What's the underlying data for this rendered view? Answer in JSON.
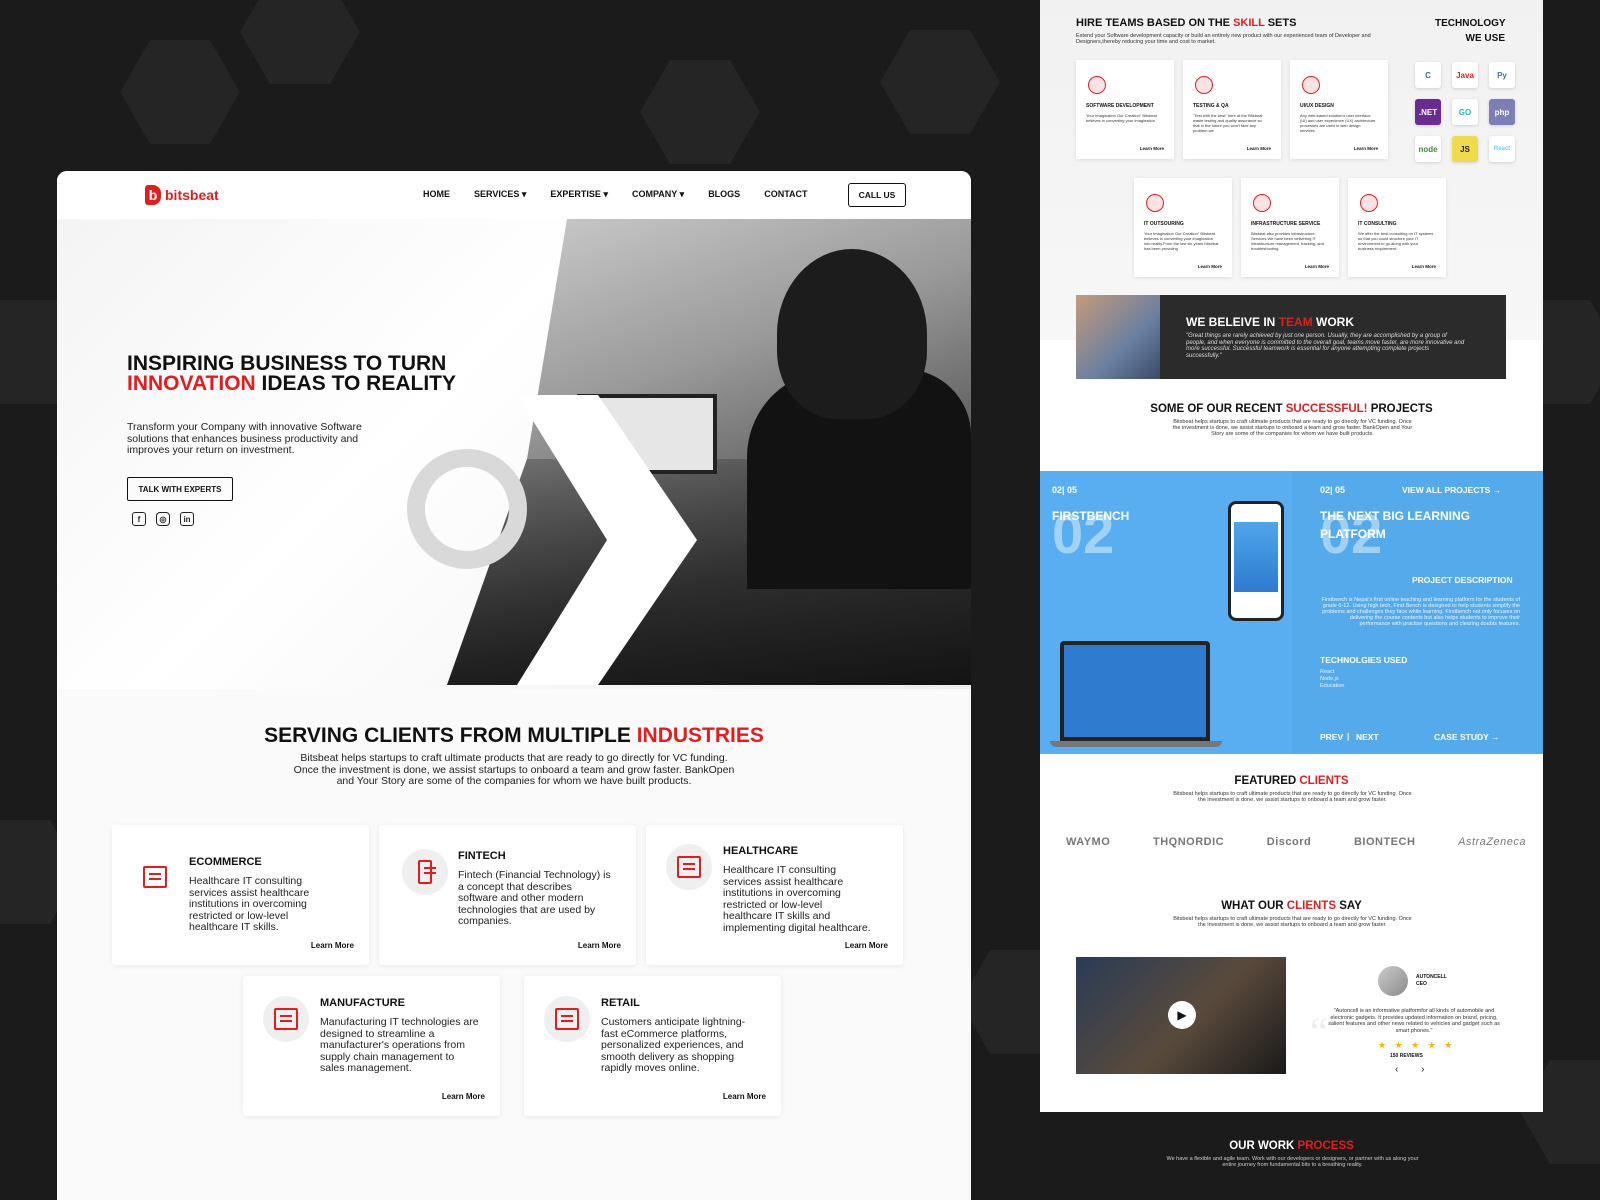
{
  "colors": {
    "accent": "#e31d1d",
    "dark": "#111111",
    "blue": "#54aaea"
  },
  "left": {
    "logo_text": "bitsbeat",
    "nav": [
      "HOME",
      "SERVICES",
      "EXPERTISE",
      "COMPANY",
      "BLOGS",
      "CONTACT"
    ],
    "nav_call": "CALL US",
    "hero": {
      "h_line1": "INSPIRING BUSINESS TO TURN",
      "h_red": "INNOVATION",
      "h_rest": " IDEAS TO REALITY",
      "text": "Transform your Company with innovative Software solutions that enhances business productivity and improves your return on investment.",
      "cta": "TALK WITH EXPERTS"
    },
    "serve": {
      "title_a": "SERVING CLIENTS FROM MULTIPLE ",
      "title_red": "INDUSTRIES",
      "text": "Bitsbeat helps startups to craft ultimate products that are ready to go directly for VC funding. Once the investment is done, we assist startups to onboard a team and grow faster. BankOpen and Your Story are some of the companies for whom we have built products."
    },
    "industries": [
      {
        "title": "ECOMMERCE",
        "text": "Healthcare IT consulting services assist healthcare institutions in overcoming restricted or low-level healthcare IT skills.",
        "link": "Learn More"
      },
      {
        "title": "FINTECH",
        "text": "Fintech (Financial Technology) is a concept that describes software and other modern technologies that are used by companies.",
        "link": "Learn More"
      },
      {
        "title": "HEALTHCARE",
        "text": "Healthcare IT consulting services assist healthcare institutions in overcoming restricted or low-level healthcare IT skills and implementing digital healthcare.",
        "link": "Learn More"
      },
      {
        "title": "MANUFACTURE",
        "text": "Manufacturing IT technologies are designed to streamline a manufacturer's operations from supply chain management to sales management.",
        "link": "Learn More"
      },
      {
        "title": "RETAIL",
        "text": "Customers anticipate lightning-fast eCommerce platforms, personalized experiences, and smooth delivery as shopping rapidly moves online.",
        "link": "Learn More"
      }
    ]
  },
  "right": {
    "skills": {
      "title_a": "HIRE TEAMS BASED ON THE ",
      "title_red": "SKILL",
      "title_b": " SETS",
      "text": "Extend your Software development capacity or build an entirely new product with our experienced team of Developer and Designers,thereby reducing your time and cost to market.",
      "tech_title": "TECHNOLOGY WE USE",
      "tech": [
        "C",
        "Java",
        "Py",
        ".NET",
        "GO",
        "php",
        "node",
        "JS",
        "React"
      ],
      "items": [
        {
          "title": "SOFTWARE DEVELOPMENT",
          "text": "Your Imagination Our Creation\" Bitsbeat believes in converting your imagination",
          "link": "Learn More"
        },
        {
          "title": "TESTING & QA",
          "text": "\"Test with the best\" here at the Bitsbeat waste testing and quality assurance so that in the future you won't face any problem.we",
          "link": "Learn More"
        },
        {
          "title": "UI/UX DESIGN",
          "text": "Any web-based solution's user interface (UI) and user experience (UX) architecture processes are used in web design services.",
          "link": "Learn More"
        },
        {
          "title": "IT OUTSOURING",
          "text": "Your Imagination Our Creation\" Bitsbeat believes in converting your imagination into reality.From the last six years bitsbeat has been providing",
          "link": "Learn More"
        },
        {
          "title": "INFRASTRUCTURE SERVICE",
          "text": "Bitsbeat also provides infrastructure Services.We have been delivering IT infrastructure management, tracking, and troubleshooting.",
          "link": "Learn More"
        },
        {
          "title": "IT CONSULTING",
          "text": "We offer the best consulting on IT systems so that you could structure your IT environment to go along with your business requirement.",
          "link": "Learn More"
        }
      ]
    },
    "team": {
      "title_a": "WE BELEIVE IN ",
      "title_red": "TEAM",
      "title_b": " WORK",
      "text": "\"Great things are rarely achieved by just one person. Usually, they are accomplished by a group of people, and when everyone is committed to the overall goal, teams move faster, are more innovative and more successful. Successful teamwork is essential for anyone attempting complete projects successfully.\""
    },
    "recent": {
      "title_a": "SOME OF OUR RECENT ",
      "title_red": "SUCCESSFUL!",
      "title_b": " PROJECTS",
      "text": "Bitsbeat helps startups to craft ultimate products that are ready to go directly for VC funding. Once the investment is done, we assist startups to onboard a team and grow faster. BankOpen and Your Story are some of the companies for whom we have built products."
    },
    "project": {
      "counter_left": "02| 05",
      "name": "FIRSTBENCH",
      "big_num": "02",
      "counter_right": "02| 05",
      "view_all": "VIEW ALL PROJECTS →",
      "title": "THE NEXT BIG LEARNING PLATFORM",
      "desc_label": "PROJECT DESCRIPTION",
      "desc": "Firstbench is Nepal's first online teaching and learning platform for the students of grade 6-12. Using high tech, First Bench is designed to help students simplify the problems and challenges they face while learning. Firstbench not only focuses on delivering the course contents but also helps students to improve their performance with practise questions and clearing doubts features.",
      "tech_label": "TECHNOLGIES USED",
      "tech": [
        "React",
        "Node.js",
        "Education"
      ],
      "prev": "PREV",
      "next": "NEXT",
      "case": "CASE STUDY →"
    },
    "clients": {
      "title_a": "FEATURED ",
      "title_red": "CLIENTS",
      "text": "Bitsbeat helps startups to craft ultimate products that are ready to go directly for VC funding. Once the investment is done, we assist startups to onboard a team and grow faster.",
      "logos": [
        "WAYMO",
        "THQNORDIC",
        "Discord",
        "BIONTECH",
        "AstraZeneca"
      ]
    },
    "say": {
      "title_a": "WHAT OUR ",
      "title_red": "CLIENTS",
      "title_b": " SAY",
      "text": "Bitsbeat helps startups to craft ultimate products that are ready to go directly for VC funding. Once the investment is done, we assist startups to onboard a team and grow faster.",
      "name": "AUTONCELL",
      "role": "CEO",
      "quote": "\"Autoncell is an informative platformfor all kinds of automobile and electronic gadgets. It provides updated information on brand, pricing, salient features and other news related to vehicles and gadget such as smart phones.\"",
      "stars": "★ ★ ★ ★ ★",
      "reviews": "150 REVIEWS",
      "arrows": "‹ ›"
    },
    "process": {
      "title_a": "OUR WORK ",
      "title_red": "PROCESS",
      "text": "We have a flexible and agile team. Work with our developers or designers, or partner with us along your entire journey from fundamental bits to a breathing reality."
    }
  }
}
